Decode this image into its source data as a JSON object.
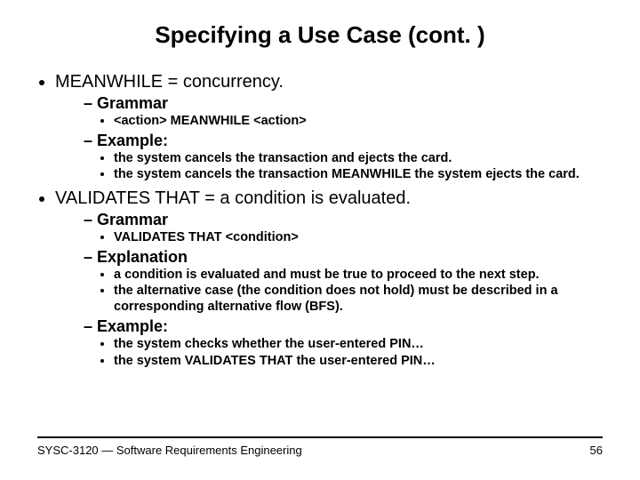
{
  "title": "Specifying a Use Case (cont. )",
  "b1": {
    "head": "MEANWHILE = concurrency.",
    "s1": {
      "head": "Grammar",
      "i1": "<action> MEANWHILE <action>"
    },
    "s2": {
      "head": "Example:",
      "i1": "the system cancels the transaction and ejects the card.",
      "i2": "the system cancels the transaction MEANWHILE the system ejects the card."
    }
  },
  "b2": {
    "head": "VALIDATES THAT = a condition is evaluated.",
    "s1": {
      "head": "Grammar",
      "i1": "VALIDATES THAT <condition>"
    },
    "s2": {
      "head": "Explanation",
      "i1": "a condition is evaluated and must be true to proceed to the next step.",
      "i2": "the alternative case (the condition does not hold) must be described in a corresponding alternative flow (BFS)."
    },
    "s3": {
      "head": "Example:",
      "i1": "the system checks whether the user-entered PIN…",
      "i2": "the system VALIDATES THAT the user-entered PIN…"
    }
  },
  "footer": {
    "left": "SYSC-3120 — Software Requirements Engineering",
    "right": "56"
  }
}
